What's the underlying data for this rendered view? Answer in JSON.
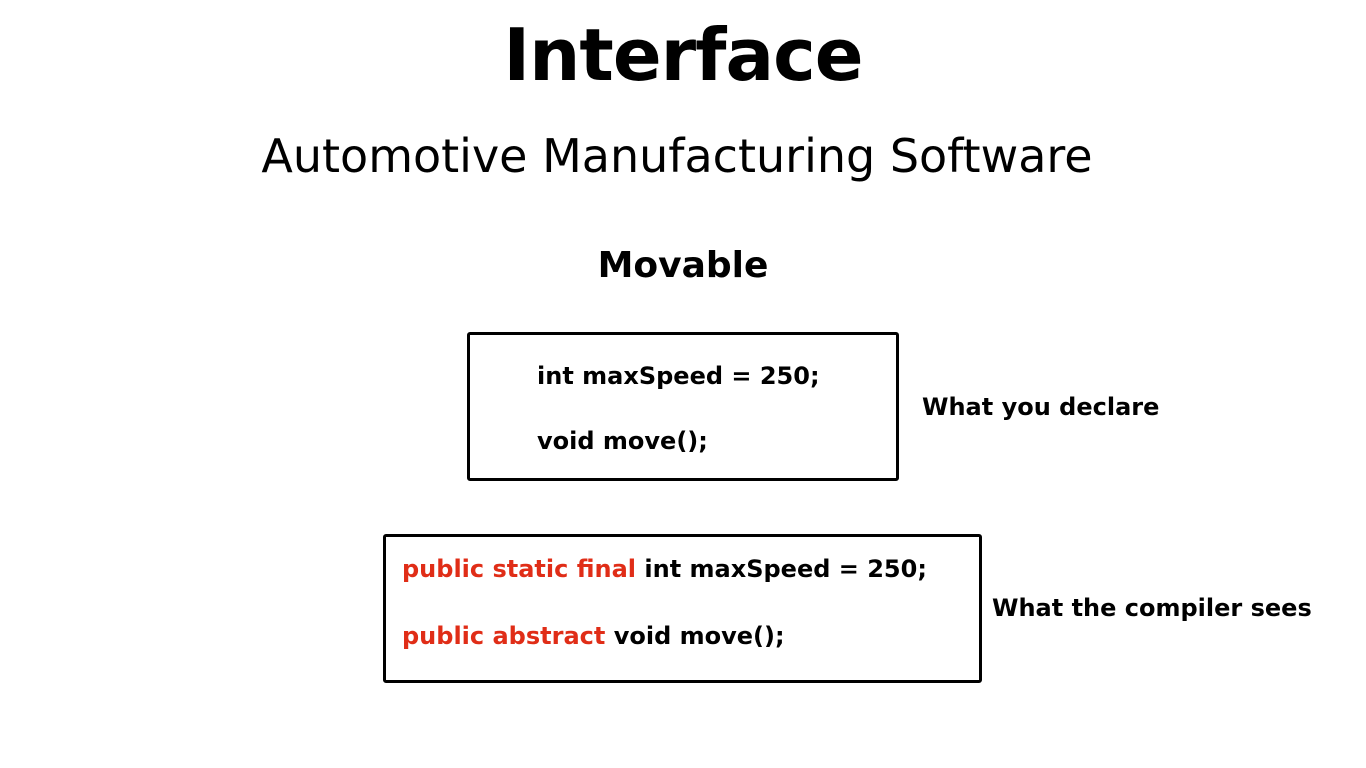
{
  "title": "Interface",
  "subtitle": "Automotive Manufacturing Software",
  "interface_name": "Movable",
  "declared_box": {
    "lines": [
      "int maxSpeed = 250;",
      "void move();"
    ],
    "label": "What you declare"
  },
  "compiler_box": {
    "lines": [
      {
        "modifiers": "public static final",
        "code": "int maxSpeed = 250;"
      },
      {
        "modifiers": "public abstract",
        "code": "void move();"
      }
    ],
    "label": "What the compiler sees"
  },
  "colors": {
    "modifier_text": "#e02d17",
    "text": "#000000",
    "background": "#ffffff"
  }
}
